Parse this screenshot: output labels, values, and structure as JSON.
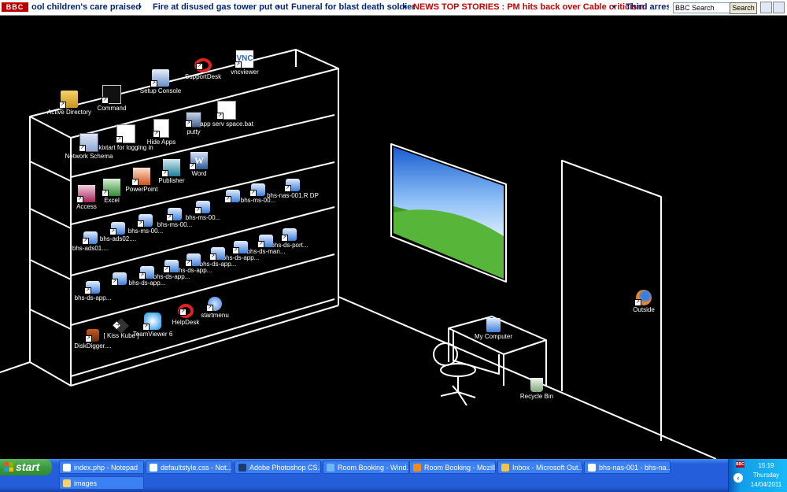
{
  "ticker": {
    "logo": "BBC",
    "items": [
      {
        "text": "ool children's care praised"
      },
      {
        "text": "Fire at disused gas tower put out"
      },
      {
        "text": "Funeral for blast death soldier"
      },
      {
        "text": "NEWS TOP STORIES : PM hits back over Cable criticism"
      },
      {
        "text": "Third arrest i"
      }
    ],
    "search_value": "BBC Search",
    "search_button": "Search"
  },
  "desktop_icons": [
    {
      "label": "Active Directory",
      "icon": "folder-people-icon"
    },
    {
      "label": "Command",
      "icon": "console-icon"
    },
    {
      "label": "Setup Console",
      "icon": "setup-console-icon"
    },
    {
      "label": "SupportDesk",
      "icon": "lifebuoy-icon"
    },
    {
      "label": "vncviewer",
      "icon": "vnc-icon"
    },
    {
      "label": "Network Schema",
      "icon": "visio-icon"
    },
    {
      "label": "kixtart for logging in",
      "icon": "script-icon"
    },
    {
      "label": "Hide Apps",
      "icon": "document-icon"
    },
    {
      "label": "putty",
      "icon": "putty-icon"
    },
    {
      "label": "app serv space.bat",
      "icon": "batch-icon"
    },
    {
      "label": "Access",
      "icon": "access-icon"
    },
    {
      "label": "Excel",
      "icon": "excel-icon"
    },
    {
      "label": "PowerPoint",
      "icon": "powerpoint-icon"
    },
    {
      "label": "Publisher",
      "icon": "publisher-icon"
    },
    {
      "label": "Word",
      "icon": "word-icon"
    },
    {
      "label": "bhs-ms-00...",
      "icon": "network-computer-icon"
    },
    {
      "label": "bhs-ms-00...",
      "icon": "network-computer-icon"
    },
    {
      "label": "bhs-nas-001.R DP",
      "icon": "network-computer-icon"
    },
    {
      "label": "bhs-ms-00...",
      "icon": "network-computer-icon"
    },
    {
      "label": "bhs-ms-00...",
      "icon": "network-computer-icon"
    },
    {
      "label": "bhs-ms-00...",
      "icon": "network-computer-icon"
    },
    {
      "label": "bhs-ads02....",
      "icon": "network-computer-icon"
    },
    {
      "label": "bhs-ads01....",
      "icon": "network-computer-icon"
    },
    {
      "label": "bhs-ds-port...",
      "icon": "network-computer-icon"
    },
    {
      "label": "bhs-ds-man...",
      "icon": "network-computer-icon"
    },
    {
      "label": "bhs-ds-app...",
      "icon": "network-computer-icon"
    },
    {
      "label": "bhs-ds-app...",
      "icon": "network-computer-icon"
    },
    {
      "label": "bhs-ds-app...",
      "icon": "network-computer-icon"
    },
    {
      "label": "bhs-ds-app...",
      "icon": "network-computer-icon"
    },
    {
      "label": "bhs-ds-app...",
      "icon": "network-computer-icon"
    },
    {
      "label": "bhs-ds-app...",
      "icon": "network-computer-icon"
    },
    {
      "label": "startmenu",
      "icon": "network-places-icon"
    },
    {
      "label": "HelpDesk",
      "icon": "lifebuoy-icon"
    },
    {
      "label": "TeamViewer 6",
      "icon": "teamviewer-icon"
    },
    {
      "label": "[ Kiss Kube ]",
      "icon": "kiss-kube-icon"
    },
    {
      "label": "DiskDigger....",
      "icon": "diskdigger-icon"
    },
    {
      "label": "My Computer",
      "icon": "my-computer-icon"
    },
    {
      "label": "Recycle Bin",
      "icon": "recycle-bin-icon"
    },
    {
      "label": "Outside",
      "icon": "firefox-icon"
    }
  ],
  "taskbar": {
    "start_label": "start",
    "buttons": [
      {
        "label": "index.php - Notepad",
        "icon": "notepad-icon"
      },
      {
        "label": "defaultstyle.css - Not...",
        "icon": "notepad-icon"
      },
      {
        "label": "Adobe Photoshop CS...",
        "icon": "photoshop-icon"
      },
      {
        "label": "Room Booking - Wind...",
        "icon": "ie-icon"
      },
      {
        "label": "Room Booking - Mozill...",
        "icon": "firefox-icon"
      },
      {
        "label": "Inbox - Microsoft Out...",
        "icon": "outlook-icon"
      },
      {
        "label": "bhs-nas-001 - bhs-na...",
        "icon": "remote-desktop-icon"
      },
      {
        "label": "images",
        "icon": "folder-icon"
      }
    ],
    "clock": {
      "time": "15:19",
      "day": "Thursday",
      "date": "14/04/2011"
    }
  },
  "colors": {
    "desktop_bg": "#000000",
    "lines": "#ffffff",
    "taskbar": "#245edb",
    "start": "#3c9b3c",
    "ticker_text": "#02257a",
    "ticker_highlight": "#cc0000"
  }
}
